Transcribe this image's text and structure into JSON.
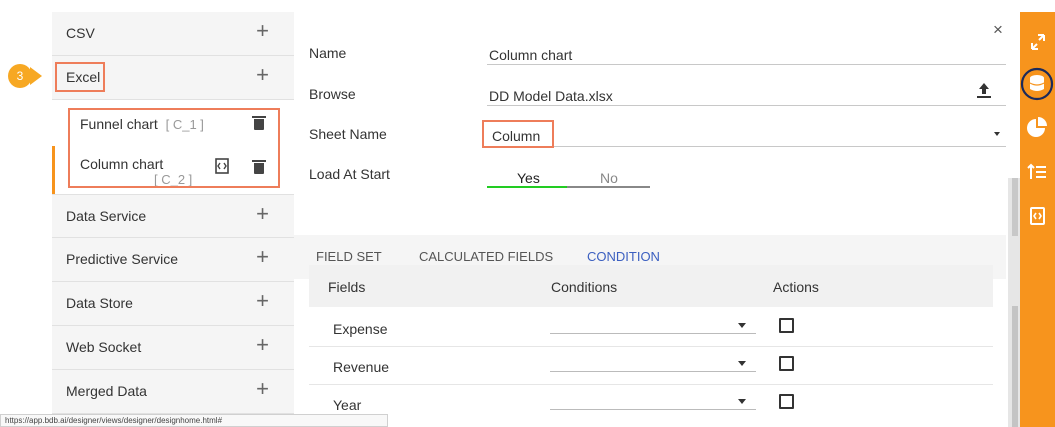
{
  "left_panel": {
    "rows": [
      {
        "label": "CSV"
      },
      {
        "label": "Excel"
      },
      {
        "label": "Data Service"
      },
      {
        "label": "Predictive Service"
      },
      {
        "label": "Data Store"
      },
      {
        "label": "Web Socket"
      },
      {
        "label": "Merged Data"
      }
    ],
    "plus_symbol": "+",
    "excel_items": [
      {
        "label": "Funnel chart",
        "code": "[ C_1 ]"
      },
      {
        "label": "Column chart",
        "code": "[ C_2 ]"
      }
    ],
    "step_number": "3"
  },
  "status_bar": {
    "url": "https://app.bdb.ai/designer/views/designer/designhome.html#"
  },
  "form": {
    "close_symbol": "×",
    "name_label": "Name",
    "name_value": "Column chart",
    "browse_label": "Browse",
    "browse_value": "DD Model Data.xlsx",
    "sheet_label": "Sheet Name",
    "sheet_value": "Column",
    "load_label": "Load At Start",
    "load_yes": "Yes",
    "load_no": "No",
    "load_selected": "Yes"
  },
  "tabs": [
    {
      "label": "FIELD SET",
      "active": false
    },
    {
      "label": "CALCULATED FIELDS",
      "active": false
    },
    {
      "label": "CONDITION",
      "active": true
    }
  ],
  "grid": {
    "headers": {
      "fields": "Fields",
      "conditions": "Conditions",
      "actions": "Actions"
    },
    "rows": [
      {
        "field": "Expense"
      },
      {
        "field": "Revenue"
      },
      {
        "field": "Year"
      }
    ]
  },
  "sidebar_right": {
    "icons": [
      "expand-icon",
      "database-icon",
      "pie-chart-icon",
      "sort-order-icon",
      "script-icon"
    ],
    "accent": "#f7941d"
  },
  "colors": {
    "accent_orange": "#f7941d",
    "highlight_box": "#ee7d5a",
    "active_tab": "#3b5fc0",
    "yes_underline": "#22cc22"
  }
}
